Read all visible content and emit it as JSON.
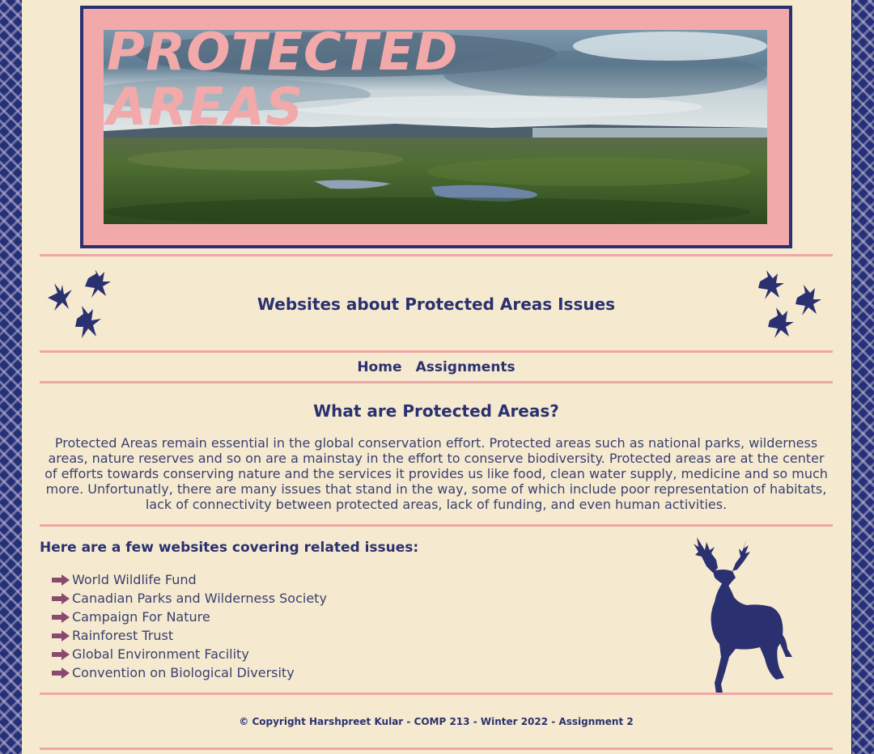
{
  "banner": {
    "title_line1": "Protected",
    "title_line2": "Areas"
  },
  "heading": {
    "title": "Websites about Protected Areas Issues"
  },
  "nav": {
    "items": [
      {
        "label": "Home"
      },
      {
        "label": "Assignments"
      }
    ]
  },
  "intro": {
    "title": "What are Protected Areas?",
    "body": "Protected Areas remain essential in the global conservation effort. Protected areas such as national parks, wilderness areas, nature reserves and so on are a mainstay in the effort to conserve biodiversity. Protected areas are at the center of efforts towards conserving nature and the services it provides us like food, clean water supply, medicine and so much more. Unfortunatly, there are many issues that stand in the way, some of which include poor representation of habitats, lack of connectivity between protected areas, lack of funding, and even human activities."
  },
  "sites": {
    "title": "Here are a few websites covering related issues:",
    "items": [
      {
        "label": "World Wildlife Fund"
      },
      {
        "label": "Canadian Parks and Wilderness Society"
      },
      {
        "label": "Campaign For Nature"
      },
      {
        "label": "Rainforest Trust"
      },
      {
        "label": "Global Environment Facility"
      },
      {
        "label": "Convention on Biological Diversity"
      }
    ]
  },
  "footer": {
    "text": "©   Copyright Harshpreet Kular - COMP 213 - Winter 2022 - Assignment 2"
  },
  "colors": {
    "navy": "#2b3170",
    "pink": "#f2a9aa",
    "cream": "#f5ead0",
    "arrow": "#8a4a6e"
  },
  "icons": {
    "birds": "bird-flock-icon",
    "arrow": "arrow-right-icon",
    "deer": "deer-icon"
  }
}
